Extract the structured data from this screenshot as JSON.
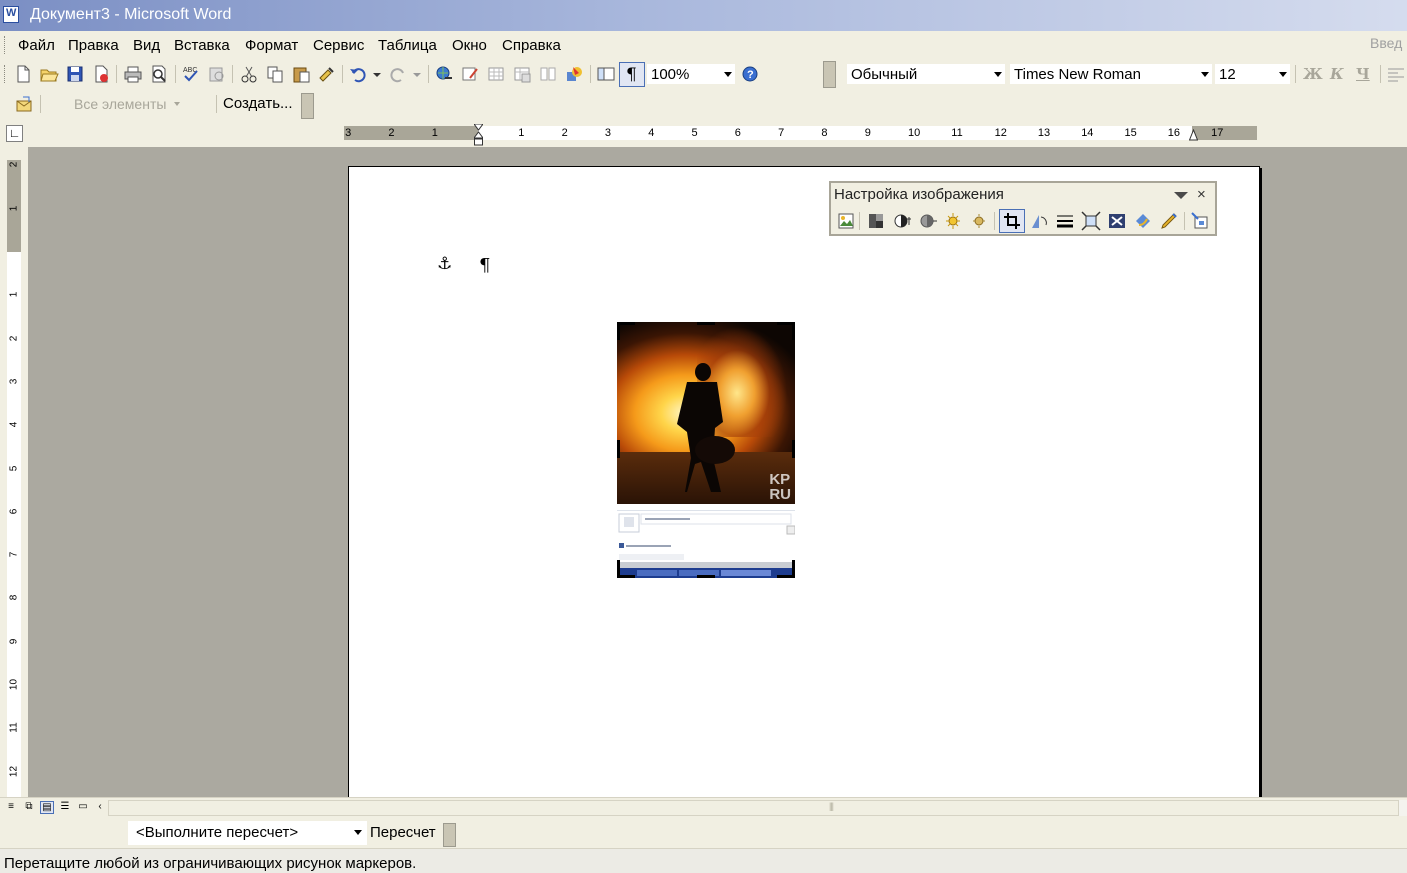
{
  "window": {
    "title": "Документ3 - Microsoft Word"
  },
  "menu": {
    "items": [
      {
        "label": "Файл"
      },
      {
        "label": "Правка"
      },
      {
        "label": "Вид"
      },
      {
        "label": "Вставка"
      },
      {
        "label": "Формат"
      },
      {
        "label": "Сервис"
      },
      {
        "label": "Таблица"
      },
      {
        "label": "Окно"
      },
      {
        "label": "Справка"
      }
    ],
    "help_box_placeholder": "Введ"
  },
  "standard_toolbar": {
    "zoom": "100%",
    "icons": [
      "new-icon",
      "open-icon",
      "save-icon",
      "permission-icon",
      "print-icon",
      "print-preview-icon",
      "spelling-icon",
      "research-icon",
      "cut-icon",
      "copy-icon",
      "paste-icon",
      "format-painter-icon",
      "undo-icon",
      "redo-icon",
      "hyperlink-icon",
      "tables-borders-icon",
      "insert-table-icon",
      "insert-excel-icon",
      "columns-icon",
      "drawing-icon",
      "document-map-icon",
      "show-formatting-icon",
      "help-icon"
    ]
  },
  "formatting_toolbar": {
    "style": "Обычный",
    "font": "Times New Roman",
    "size": "12",
    "bold": "Ж",
    "italic": "К",
    "underline": "Ч"
  },
  "mail_toolbar": {
    "all_items": "Все элементы",
    "create": "Создать..."
  },
  "ruler": {
    "horizontal_numbers": [
      "3",
      "2",
      "1",
      "1",
      "2",
      "3",
      "4",
      "5",
      "6",
      "7",
      "8",
      "9",
      "10",
      "11",
      "12",
      "13",
      "14",
      "15",
      "16",
      "17"
    ],
    "vertical_numbers": [
      "2",
      "1",
      "1",
      "2",
      "3",
      "4",
      "5",
      "6",
      "7",
      "8",
      "9",
      "10",
      "11",
      "12"
    ]
  },
  "document": {
    "anchor_symbol": "⚓",
    "paragraph_mark": "¶",
    "watermark_line1": "KP",
    "watermark_line2": "RU"
  },
  "picture_toolbar": {
    "title": "Настройка изображения",
    "close": "×",
    "icons": [
      "insert-picture-icon",
      "color-icon",
      "more-contrast-icon",
      "less-contrast-icon",
      "more-brightness-icon",
      "less-brightness-icon",
      "crop-icon",
      "rotate-icon",
      "line-style-icon",
      "compress-icon",
      "text-wrapping-icon",
      "format-picture-icon",
      "set-transparent-color-icon",
      "reset-picture-icon"
    ]
  },
  "recalc": {
    "combo_value": "<Выполните пересчет>",
    "button": "Пересчет"
  },
  "status": {
    "text": "Перетащите любой из ограничивающих рисунок маркеров."
  },
  "colors": {
    "chrome": "#f1efe2",
    "workspace": "#aba9a0",
    "titlebar": "#7b8fc4"
  }
}
